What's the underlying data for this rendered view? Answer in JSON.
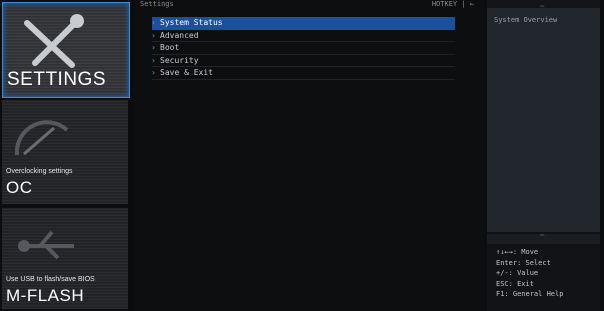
{
  "sidebar": {
    "settings": {
      "title": "SETTINGS"
    },
    "oc": {
      "subtitle": "Overclocking settings",
      "title": "OC"
    },
    "mflash": {
      "subtitle": "Use USB to flash/save BIOS",
      "title": "M-FLASH"
    }
  },
  "main": {
    "header": "Settings",
    "hotkey": "HOTKEY | ←",
    "items": [
      {
        "label": "System Status"
      },
      {
        "label": "Advanced"
      },
      {
        "label": "Boot"
      },
      {
        "label": "Security"
      },
      {
        "label": "Save & Exit"
      }
    ]
  },
  "right": {
    "overview_title": "System Overview",
    "help": [
      "↑↓←→: Move",
      "Enter: Select",
      "+/-: Value",
      "ESC: Exit",
      "F1: General Help"
    ]
  },
  "colors": {
    "accent": "#1c4f9c",
    "chevron": "#4e9ae6",
    "active_border": "#3a8ad8"
  }
}
